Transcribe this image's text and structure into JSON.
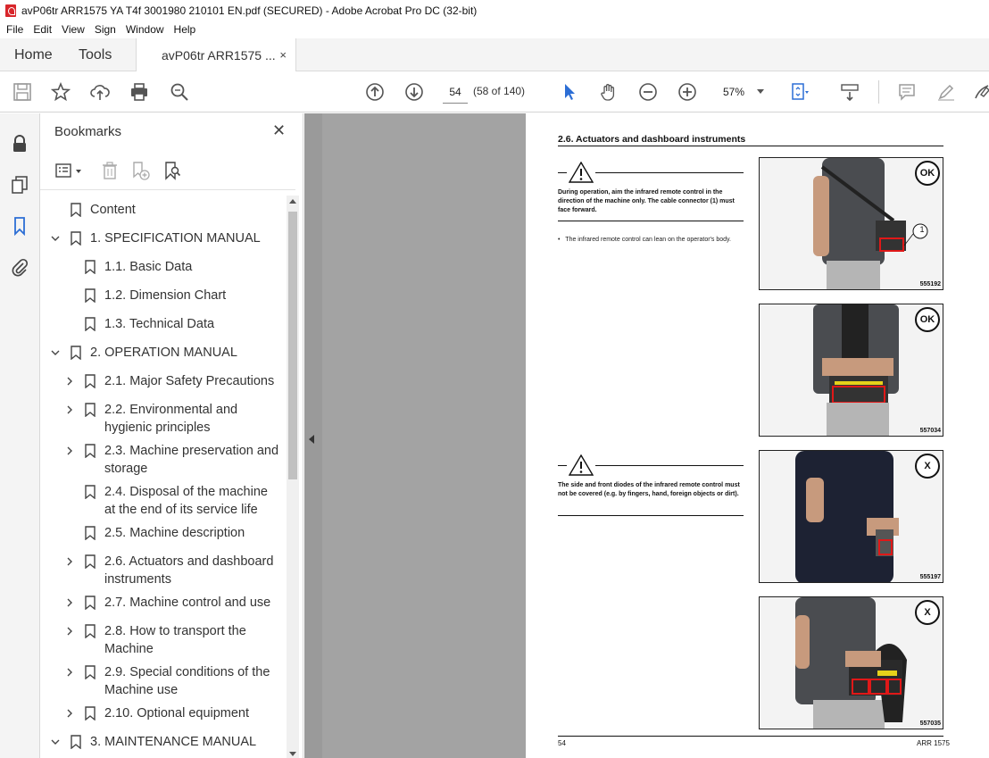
{
  "window": {
    "title": "avP06tr ARR1575 YA T4f 3001980 210101 EN.pdf (SECURED) - Adobe Acrobat Pro DC (32-bit)"
  },
  "menu": [
    "File",
    "Edit",
    "View",
    "Sign",
    "Window",
    "Help"
  ],
  "tabs": {
    "home": "Home",
    "tools": "Tools",
    "document": "avP06tr ARR1575 ...",
    "close": "×"
  },
  "toolbar": {
    "page_number": "54",
    "page_count": "(58 of 140)",
    "zoom": "57%"
  },
  "bookmarks": {
    "header": "Bookmarks",
    "close": "✕",
    "items": [
      {
        "label": "Content",
        "level": 0,
        "chevron": "none"
      },
      {
        "label": "1. SPECIFICATION MANUAL",
        "level": 0,
        "chevron": "down"
      },
      {
        "label": "1.1. Basic Data",
        "level": 1,
        "chevron": "none"
      },
      {
        "label": "1.2. Dimension Chart",
        "level": 1,
        "chevron": "none"
      },
      {
        "label": "1.3. Technical Data",
        "level": 1,
        "chevron": "none"
      },
      {
        "label": "2. OPERATION MANUAL",
        "level": 0,
        "chevron": "down"
      },
      {
        "label": "2.1. Major Safety Precautions",
        "level": 1,
        "chevron": "right"
      },
      {
        "label": "2.2. Environmental and",
        "label2": "hygienic principles",
        "level": 1,
        "chevron": "right"
      },
      {
        "label": "2.3. Machine preservation and",
        "label2": "storage",
        "level": 1,
        "chevron": "right"
      },
      {
        "label": "2.4. Disposal of the machine",
        "label2": "at the end of its service life",
        "level": 1,
        "chevron": "none"
      },
      {
        "label": "2.5. Machine description",
        "level": 1,
        "chevron": "none"
      },
      {
        "label": "2.6. Actuators and dashboard",
        "label2": "instruments",
        "level": 1,
        "chevron": "right"
      },
      {
        "label": "2.7. Machine control and use",
        "level": 1,
        "chevron": "right"
      },
      {
        "label": "2.8. How to transport the",
        "label2": "Machine",
        "level": 1,
        "chevron": "right"
      },
      {
        "label": "2.9. Special conditions of the",
        "label2": "Machine use",
        "level": 1,
        "chevron": "right"
      },
      {
        "label": "2.10. Optional equipment",
        "level": 1,
        "chevron": "right"
      },
      {
        "label": "3. MAINTENANCE MANUAL",
        "level": 0,
        "chevron": "down"
      }
    ]
  },
  "document_page": {
    "section_title": "2.6.    Actuators and dashboard instruments",
    "warning1": "During operation, aim the infrared remote control in the direction of the machine only. The cable connector (1) must face forward.",
    "bullet1": "The infrared remote control can lean on the operator's body.",
    "warning2": "The side and front diodes of the infrared remote control must not be covered (e.g. by fingers, hand, foreign objects or dirt).",
    "photos": [
      {
        "code": "555192",
        "mark": "OK",
        "callout": "1"
      },
      {
        "code": "557034",
        "mark": "OK"
      },
      {
        "code": "555197",
        "mark": "X"
      },
      {
        "code": "557035",
        "mark": "X"
      }
    ],
    "footer_page": "54",
    "footer_model": "ARR 1575"
  }
}
